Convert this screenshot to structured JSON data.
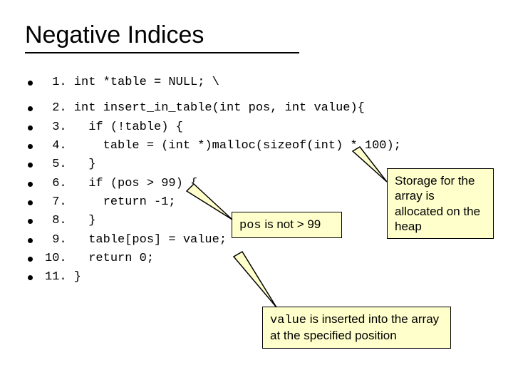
{
  "title": "Negative Indices",
  "code": {
    "l1": " 1. int *table = NULL; \\",
    "l2": " 2. int insert_in_table(int pos, int value){",
    "l3": " 3.   if (!table) {",
    "l4": " 4.     table = (int *)malloc(sizeof(int) * 100);",
    "l5": " 5.   }",
    "l6": " 6.   if (pos > 99) {",
    "l7": " 7.     return -1;",
    "l8": " 8.   }",
    "l9": " 9.   table[pos] = value;",
    "l10": "10.   return 0;",
    "l11": "11. }"
  },
  "callouts": {
    "storage": "Storage for the array is allocated on the heap",
    "pos_prefix": "pos",
    "pos_rest": " is not > 99",
    "value_prefix": "value",
    "value_rest": " is inserted into the array at the specified position"
  }
}
